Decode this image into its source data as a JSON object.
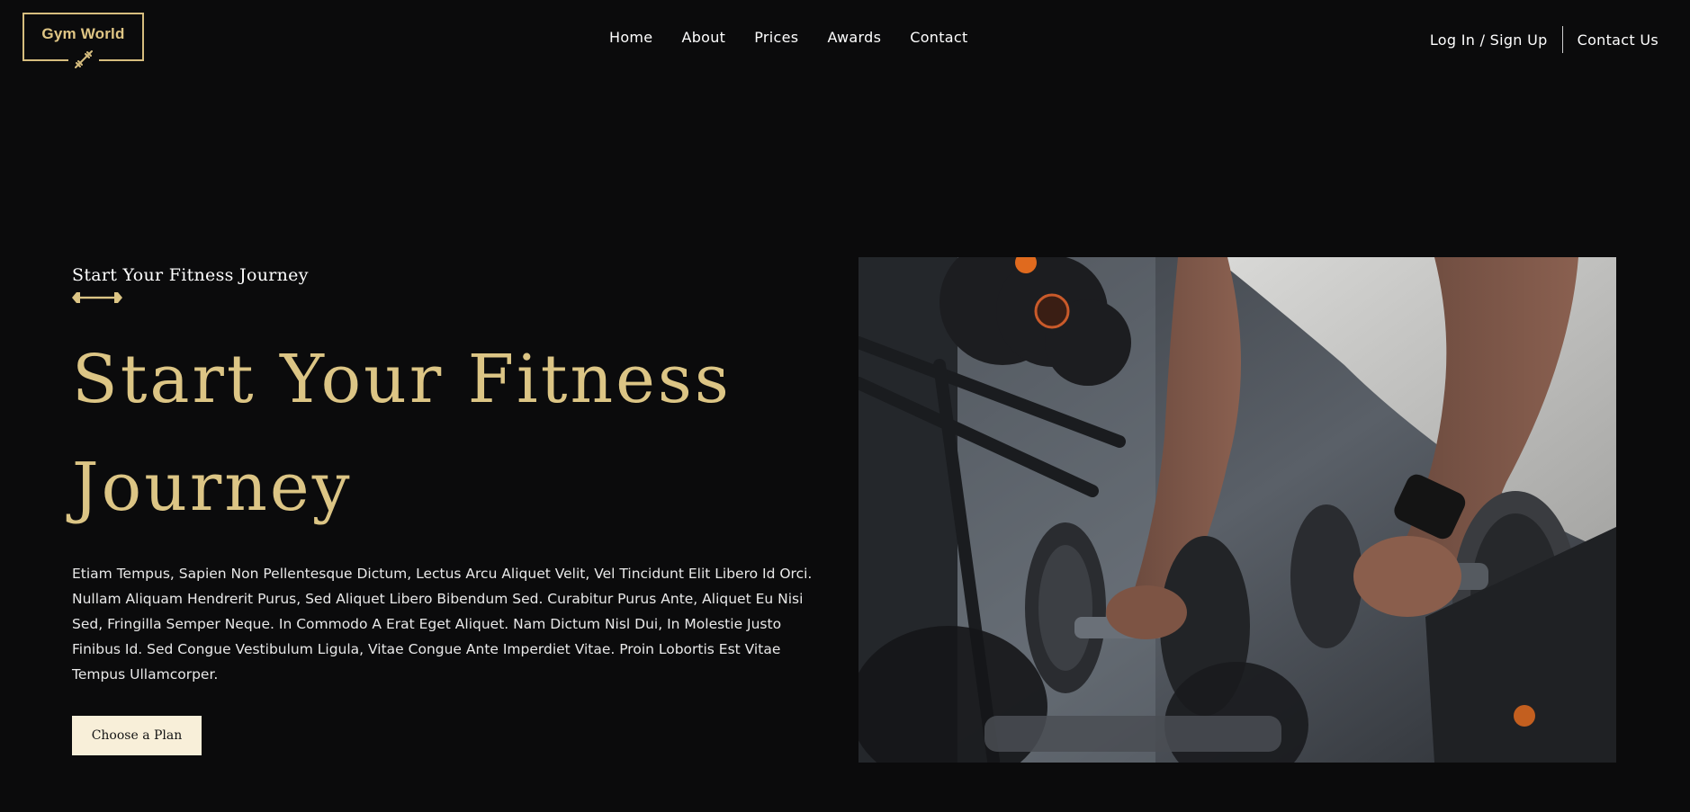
{
  "header": {
    "logo_text": "Gym World",
    "nav": [
      {
        "label": "Home"
      },
      {
        "label": "About"
      },
      {
        "label": "Prices"
      },
      {
        "label": "Awards"
      },
      {
        "label": "Contact"
      }
    ],
    "login_label": "Log In / Sign Up",
    "contact_label": "Contact Us"
  },
  "hero": {
    "eyebrow": "Start Your Fitness Journey",
    "title": "Start Your Fitness Journey",
    "body": "Etiam Tempus, Sapien Non Pellentesque Dictum, Lectus Arcu Aliquet Velit, Vel Tincidunt Elit Libero Id Orci. Nullam Aliquam Hendrerit Purus, Sed Aliquet Libero Bibendum Sed. Curabitur Purus Ante, Aliquet Eu Nisi Sed, Fringilla Semper Neque. In Commodo A Erat Eget Aliquet. Nam Dictum Nisl Dui, In Molestie Justo Finibus Id. Sed Congue Vestibulum Ligula, Vitae Congue Ante Imperdiet Vitae. Proin Lobortis Est Vitae Tempus Ullamcorper.",
    "cta_label": "Choose a Plan",
    "image_subject": "dumbbell-rack-photo"
  },
  "colors": {
    "background": "#0b0b0c",
    "accent_gold": "#dcc585",
    "cta_background": "#f8efd9",
    "text": "#ffffff"
  },
  "icons": {
    "logo": "dumbbell-icon",
    "eyebrow": "dumbbell-icon"
  }
}
